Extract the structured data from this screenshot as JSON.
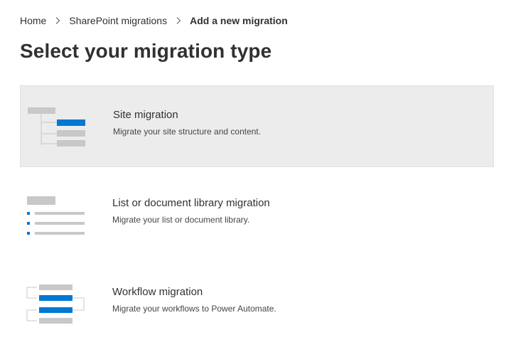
{
  "breadcrumb": {
    "items": [
      "Home",
      "SharePoint migrations"
    ],
    "current": "Add a new migration",
    "separator_icon": "chevron-right-icon"
  },
  "page_title": "Select your migration type",
  "options": [
    {
      "title": "Site migration",
      "description": "Migrate your site structure and content.",
      "icon": "site-hierarchy-illustration",
      "selected": true
    },
    {
      "title": "List or document library migration",
      "description": "Migrate your list or document library.",
      "icon": "list-illustration",
      "selected": false
    },
    {
      "title": "Workflow migration",
      "description": "Migrate your workflows to Power Automate.",
      "icon": "workflow-illustration",
      "selected": false
    }
  ],
  "colors": {
    "accent": "#0078d4",
    "placeholder_gray": "#c8c8c8",
    "line_gray": "#c8c8c8",
    "selected_background": "#ececec"
  }
}
